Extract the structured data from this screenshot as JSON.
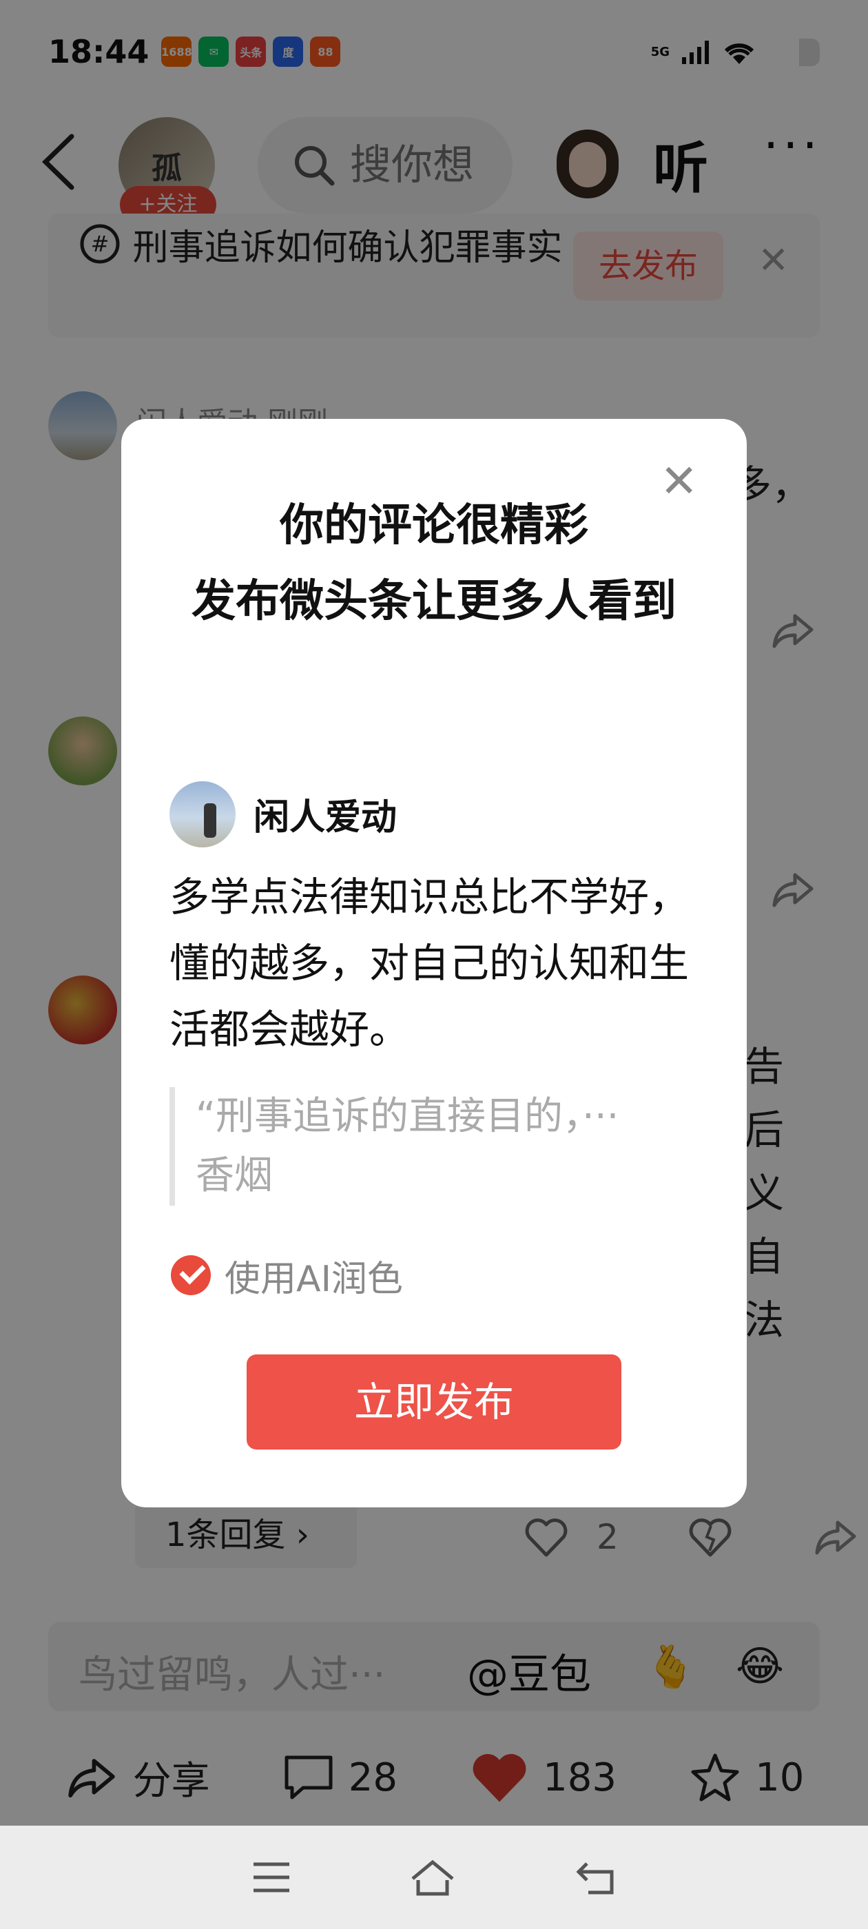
{
  "status_bar": {
    "time": "18:44",
    "apps": [
      {
        "name": "1688",
        "glyph": "1688",
        "color": "#ff6a00"
      },
      {
        "name": "wechat",
        "glyph": "✉",
        "color": "#07c160"
      },
      {
        "name": "toutiao",
        "glyph": "头条",
        "color": "#f04142"
      },
      {
        "name": "baidu",
        "glyph": "度",
        "color": "#2b6af0"
      },
      {
        "name": "app-orange",
        "glyph": "88",
        "color": "#ff5a1f"
      }
    ],
    "network": "5G",
    "battery_level": 0.6
  },
  "header": {
    "avatar_glyph": "孤",
    "follow_label": "+关注",
    "search_placeholder": "搜你想",
    "listen_label": "听",
    "more_label": "···"
  },
  "topic_banner": {
    "text": "刑事追诉如何确认犯罪事实",
    "publish_label": "去发布",
    "close_label": "✕"
  },
  "comments": [
    {
      "name": "闲人爱动 刚刚",
      "snippet": "多，"
    },
    {
      "name": "",
      "snippet": ""
    },
    {
      "name": "",
      "snippet": "告\n后\n义\n自\n法"
    }
  ],
  "reply_row": {
    "replies_label": "1条回复 ›",
    "like_count": "2"
  },
  "bottom_input": {
    "placeholder": "鸟过留鸣，人过···",
    "ai_label": "@豆包",
    "emoji_1": "🫰",
    "emoji_2": "😂"
  },
  "action_bar": {
    "share_label": "分享",
    "comment_count": "28",
    "like_count": "183",
    "favorite_count": "10"
  },
  "modal": {
    "title": "你的评论很精彩\n发布微头条让更多人看到",
    "user_name": "闲人爱动",
    "comment_text": "多学点法律知识总比不学好，懂的越多，对自己的认知和生活都会越好。",
    "quote_line1": "“刑事追诉的直接目的，···",
    "quote_line2": "香烟",
    "ai_polish_label": "使用AI润色",
    "ai_polish_checked": true,
    "publish_label": "立即发布",
    "close_label": "✕"
  },
  "colors": {
    "accent": "#ee5248",
    "follow_badge": "#e84a3c",
    "like_heart": "#d93a2e"
  }
}
